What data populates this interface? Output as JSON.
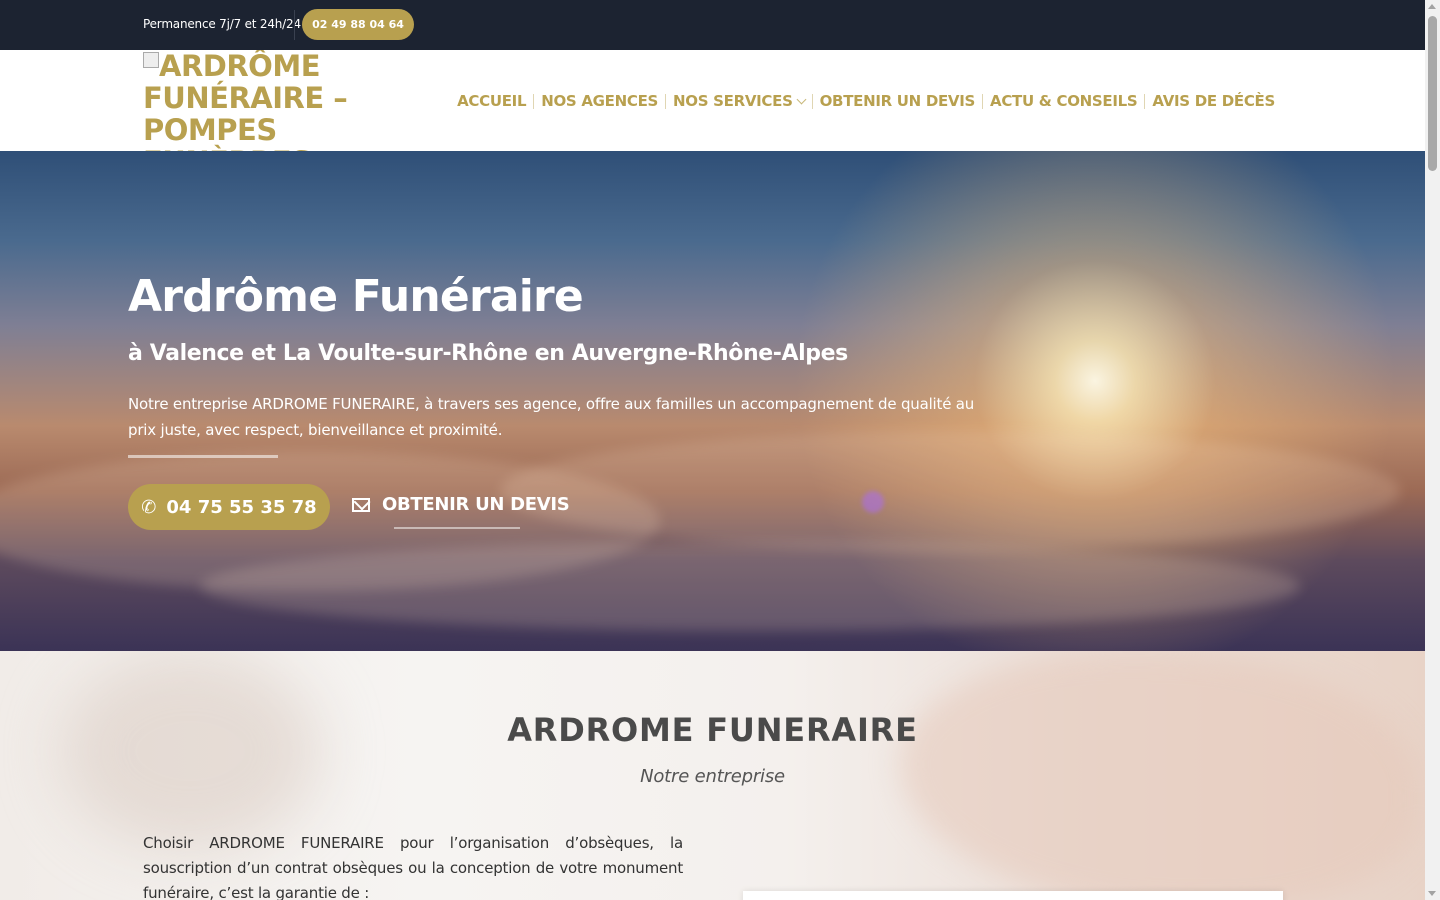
{
  "topbar": {
    "permanence": "Permanence 7j/7 et 24h/24",
    "phone": "02 49 88 04 64"
  },
  "header": {
    "logo_alt": "ARDRÔME FUNÉRAIRE – POMPES FUNÈBRES",
    "nav": [
      {
        "label": "ACCUEIL"
      },
      {
        "label": "NOS AGENCES"
      },
      {
        "label": "NOS SERVICES",
        "has_dropdown": true
      },
      {
        "label": "OBTENIR UN DEVIS"
      },
      {
        "label": "ACTU & CONSEILS"
      },
      {
        "label": "AVIS DE DÉCÈS"
      }
    ]
  },
  "hero": {
    "title": "Ardrôme Funéraire",
    "subtitle": "à Valence et La Voulte-sur-Rhône en Auvergne-Rhône-Alpes",
    "description": "Notre entreprise ARDROME FUNERAIRE, à travers ses agence, offre aux familles un accompagnement de qualité au prix juste, avec respect, bienveillance et proximité.",
    "call_button": "04 75 55 35 78",
    "devis_link": "OBTENIR UN DEVIS"
  },
  "section": {
    "title": "ARDROME FUNERAIRE",
    "subtitle": "Notre entreprise",
    "paragraph": "Choisir ARDROME FUNERAIRE pour l’organisation d’obsèques, la souscription d’un contrat obsèques ou la conception de votre monument funéraire, c’est la garantie de :"
  },
  "colors": {
    "accent_gold": "#b8a04f",
    "topbar_dark": "#1c2331",
    "heading_gray": "#4a4a4a"
  },
  "icons": {
    "call": "phone-icon",
    "devis": "mail-icon",
    "dropdown": "chevron-down-icon"
  }
}
